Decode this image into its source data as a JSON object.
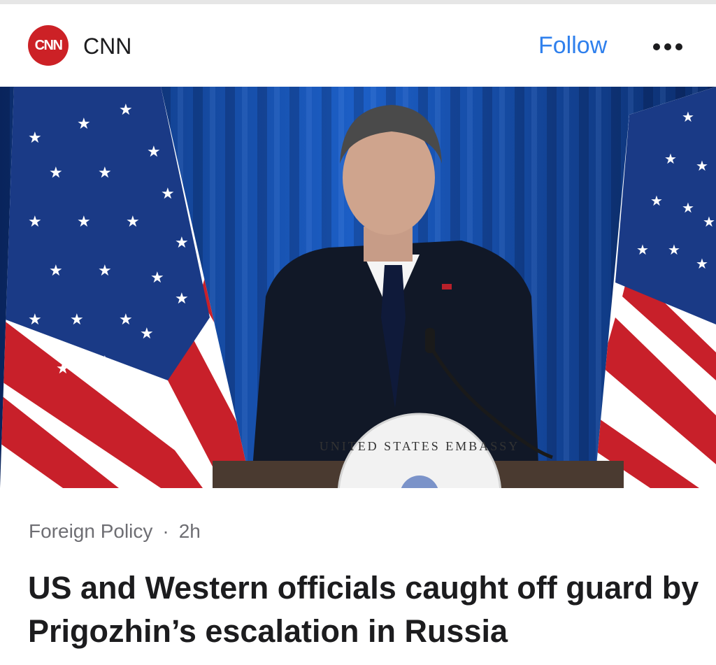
{
  "header": {
    "logo_text": "CNN",
    "source_name": "CNN",
    "follow_label": "Follow"
  },
  "colors": {
    "logo_bg": "#cc2126",
    "follow": "#2f80ed",
    "meta_text": "#6e6e73"
  },
  "image": {
    "emblem_text": "UNITED STATES EMBASSY"
  },
  "article": {
    "category": "Foreign Policy",
    "separator": "·",
    "time": "2h",
    "headline": "US and Western officials caught off guard by Prigozhin’s escalation in Russia"
  }
}
